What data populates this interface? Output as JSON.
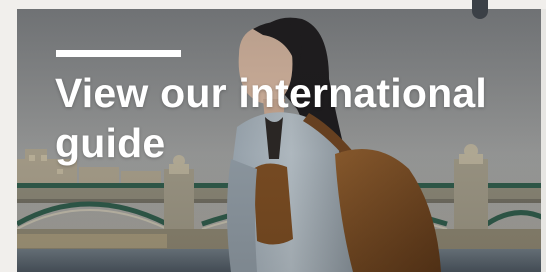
{
  "promo": {
    "headline": "View our international guide",
    "image_alt": "Woman with backpack walking by a bridge in London"
  },
  "colors": {
    "page_background": "#f1efec",
    "headline_text": "#ffffff",
    "accent_rule": "#ffffff"
  }
}
